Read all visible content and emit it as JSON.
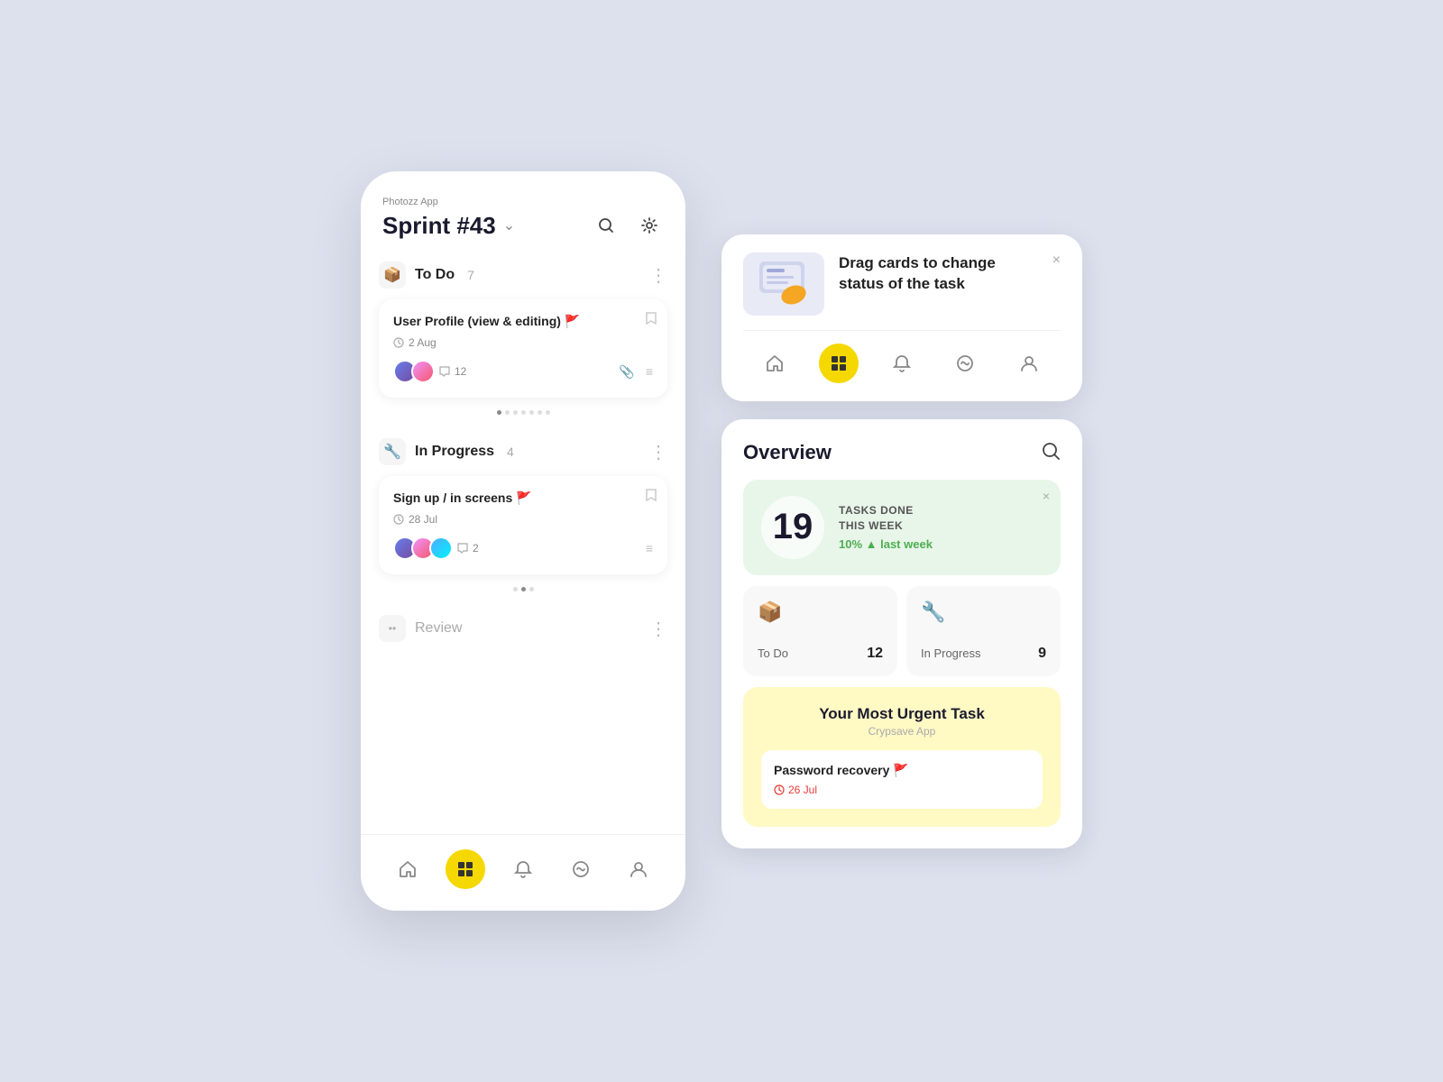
{
  "app": {
    "name": "Photozz App",
    "sprint_title": "Sprint #43"
  },
  "sections": [
    {
      "id": "todo",
      "title": "To Do",
      "count": "7",
      "icon": "📦",
      "tasks": [
        {
          "title": "User Profile (view & editing)",
          "flag": "red",
          "date": "2 Aug",
          "avatars": 2,
          "comments": 12,
          "has_attachment": true
        }
      ],
      "dots": [
        true,
        false,
        false,
        false,
        false,
        false,
        false
      ]
    },
    {
      "id": "inprogress",
      "title": "In Progress",
      "count": "4",
      "icon": "🔧",
      "tasks": [
        {
          "title": "Sign up / in screens",
          "flag": "orange",
          "date": "28 Jul",
          "avatars": 3,
          "comments": 2,
          "has_attachment": false
        }
      ],
      "dots": [
        false,
        true,
        false
      ]
    },
    {
      "id": "review",
      "title": "Review",
      "count": "",
      "icon": "••",
      "tasks": []
    }
  ],
  "nav_items": [
    {
      "id": "home",
      "icon": "⌂",
      "active": false
    },
    {
      "id": "tasks",
      "icon": "⊞",
      "active": true
    },
    {
      "id": "bell",
      "icon": "🔔",
      "active": false
    },
    {
      "id": "activity",
      "icon": "◎",
      "active": false
    },
    {
      "id": "profile",
      "icon": "◯",
      "active": false
    }
  ],
  "tooltip": {
    "title": "Drag cards to change status of the task",
    "close_label": "×"
  },
  "overview": {
    "title": "Overview",
    "tasks_done": {
      "number": "19",
      "label": "TASKS DONE\nTHIS WEEK",
      "stat": "10% ▲ last week",
      "close_label": "×"
    },
    "categories": [
      {
        "icon": "📦",
        "name": "To Do",
        "count": "12"
      },
      {
        "icon": "🔧",
        "name": "In Progress",
        "count": "9"
      }
    ],
    "urgent": {
      "title": "Your Most Urgent Task",
      "app": "Crypsave App",
      "task_name": "Password recovery",
      "flag": "red",
      "date": "26 Jul"
    }
  }
}
